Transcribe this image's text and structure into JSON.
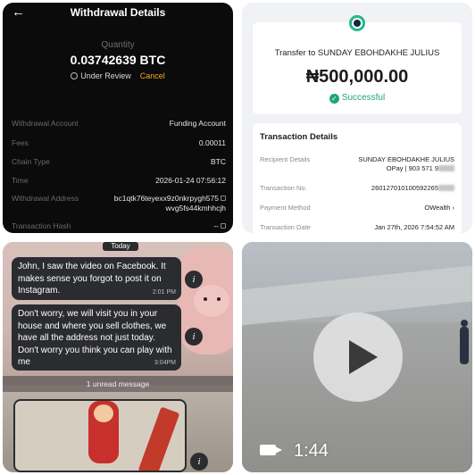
{
  "withdrawal": {
    "title": "Withdrawal Details",
    "back_icon": "←",
    "quantity_label": "Quantity",
    "quantity": "0.03742639 BTC",
    "status": "Under Review",
    "cancel": "Cancel",
    "rows": [
      {
        "label": "Withdrawal Account",
        "value": "Funding Account"
      },
      {
        "label": "Fees",
        "value": "0.00011"
      },
      {
        "label": "Chain Type",
        "value": "BTC"
      },
      {
        "label": "Time",
        "value": "2026-01-24 07:56:12"
      },
      {
        "label": "Withdrawal Address",
        "value_line1": "bc1qtk76teyexx9z0nkrpygh575",
        "value_line2": "wvg5fs44kmhhcjh"
      },
      {
        "label": "Transaction Hash",
        "value": "--"
      }
    ],
    "accent": "#f5a623"
  },
  "transfer": {
    "to": "Transfer to SUNDAY EBOHDAKHE JULIUS",
    "amount": "₦500,000.00",
    "status": "Successful",
    "section_title": "Transaction Details",
    "rows": [
      {
        "label": "Recipient Details",
        "value_line1": "SUNDAY EBOHDAKHE JULIUS",
        "value_line2": "OPay | 903 571 9"
      },
      {
        "label": "Transaction No.",
        "value": "260127010100592265"
      },
      {
        "label": "Payment Method",
        "value": "OWealth"
      },
      {
        "label": "Transaction Date",
        "value": "Jan 27th, 2026 7:54:52 AM"
      }
    ],
    "success_color": "#1fa672"
  },
  "chat": {
    "date_pill": "Today",
    "messages": [
      {
        "text": "John, I saw the video on Facebook. It makes sense you forgot to post it on Instagram.",
        "time": "2:01 PM"
      },
      {
        "text": "Don't worry, we will visit you in your house and where you sell clothes, we have all the address not just today. Don't worry you think you can play with me",
        "time": "3:04PM"
      }
    ],
    "unread": "1 unread message",
    "info_icon": "i"
  },
  "video": {
    "duration": "1:44"
  }
}
